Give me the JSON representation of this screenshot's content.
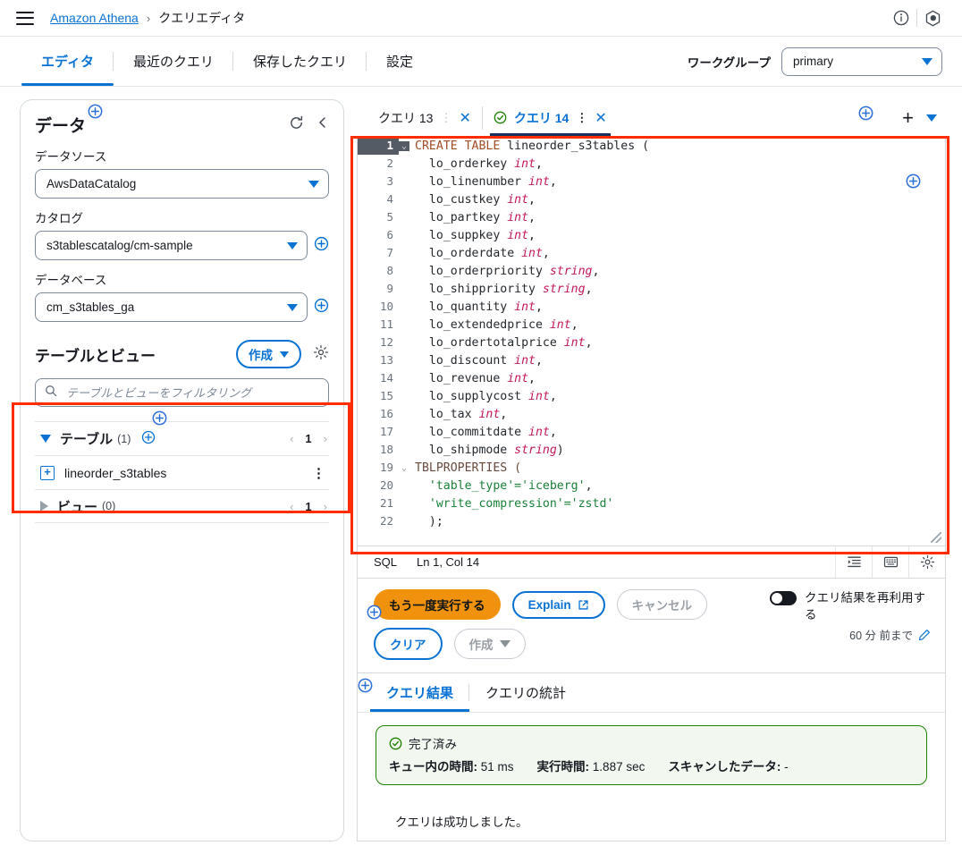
{
  "header": {
    "menu_icon": "hamburger-icon",
    "breadcrumb_root": "Amazon Athena",
    "breadcrumb_sep": "›",
    "breadcrumb_current": "クエリエディタ",
    "info_icon": "info-icon",
    "settings_icon": "app-settings-icon"
  },
  "main_tabs": [
    {
      "label": "エディタ",
      "active": true
    },
    {
      "label": "最近のクエリ",
      "active": false
    },
    {
      "label": "保存したクエリ",
      "active": false
    },
    {
      "label": "設定",
      "active": false
    }
  ],
  "workgroup": {
    "label": "ワークグループ",
    "value": "primary"
  },
  "sidebar": {
    "title": "データ",
    "refresh_icon": "refresh-icon",
    "collapse_icon": "chevron-left-icon",
    "fields": [
      {
        "label": "データソース",
        "value": "AwsDataCatalog",
        "has_add": false
      },
      {
        "label": "カタログ",
        "value": "s3tablescatalog/cm-sample",
        "has_add": true
      },
      {
        "label": "データベース",
        "value": "cm_s3tables_ga",
        "has_add": true
      }
    ],
    "tables_section": {
      "title": "テーブルとビュー",
      "create_button": "作成",
      "gear_icon": "gear-icon",
      "filter_placeholder": "テーブルとビューをフィルタリング",
      "filter_value": "",
      "search_icon": "search-icon",
      "tables_group": {
        "label": "テーブル",
        "count": "(1)",
        "page": "1"
      },
      "table_items": [
        {
          "name": "lineorder_s3tables"
        }
      ],
      "views_group": {
        "label": "ビュー",
        "count": "(0)",
        "page": "1"
      }
    }
  },
  "query_tabs": [
    {
      "label": "クエリ 13",
      "active": false,
      "status": ""
    },
    {
      "label": "クエリ 14",
      "active": true,
      "status": "success"
    }
  ],
  "editor": {
    "add_tab_icon": "plus-icon",
    "tab_menu_icon": "chevron-down-icon",
    "inline_add_icon": "circle-plus-icon",
    "lines": [
      {
        "n": "1",
        "fold": "⌄",
        "active": true,
        "tokens": [
          {
            "t": "CREATE TABLE ",
            "c": "kw"
          },
          {
            "t": "lineorder_s3tables (",
            "c": ""
          }
        ]
      },
      {
        "n": "2",
        "fold": "",
        "active": false,
        "tokens": [
          {
            "t": "  lo_orderkey ",
            "c": ""
          },
          {
            "t": "int",
            "c": "typ"
          },
          {
            "t": ",",
            "c": ""
          }
        ]
      },
      {
        "n": "3",
        "fold": "",
        "active": false,
        "tokens": [
          {
            "t": "  lo_linenumber ",
            "c": ""
          },
          {
            "t": "int",
            "c": "typ"
          },
          {
            "t": ",",
            "c": ""
          }
        ]
      },
      {
        "n": "4",
        "fold": "",
        "active": false,
        "tokens": [
          {
            "t": "  lo_custkey ",
            "c": ""
          },
          {
            "t": "int",
            "c": "typ"
          },
          {
            "t": ",",
            "c": ""
          }
        ]
      },
      {
        "n": "5",
        "fold": "",
        "active": false,
        "tokens": [
          {
            "t": "  lo_partkey ",
            "c": ""
          },
          {
            "t": "int",
            "c": "typ"
          },
          {
            "t": ",",
            "c": ""
          }
        ]
      },
      {
        "n": "6",
        "fold": "",
        "active": false,
        "tokens": [
          {
            "t": "  lo_suppkey ",
            "c": ""
          },
          {
            "t": "int",
            "c": "typ"
          },
          {
            "t": ",",
            "c": ""
          }
        ]
      },
      {
        "n": "7",
        "fold": "",
        "active": false,
        "tokens": [
          {
            "t": "  lo_orderdate ",
            "c": ""
          },
          {
            "t": "int",
            "c": "typ"
          },
          {
            "t": ",",
            "c": ""
          }
        ]
      },
      {
        "n": "8",
        "fold": "",
        "active": false,
        "tokens": [
          {
            "t": "  lo_orderpriority ",
            "c": ""
          },
          {
            "t": "string",
            "c": "typ"
          },
          {
            "t": ",",
            "c": ""
          }
        ]
      },
      {
        "n": "9",
        "fold": "",
        "active": false,
        "tokens": [
          {
            "t": "  lo_shippriority ",
            "c": ""
          },
          {
            "t": "string",
            "c": "typ"
          },
          {
            "t": ",",
            "c": ""
          }
        ]
      },
      {
        "n": "10",
        "fold": "",
        "active": false,
        "tokens": [
          {
            "t": "  lo_quantity ",
            "c": ""
          },
          {
            "t": "int",
            "c": "typ"
          },
          {
            "t": ",",
            "c": ""
          }
        ]
      },
      {
        "n": "11",
        "fold": "",
        "active": false,
        "tokens": [
          {
            "t": "  lo_extendedprice ",
            "c": ""
          },
          {
            "t": "int",
            "c": "typ"
          },
          {
            "t": ",",
            "c": ""
          }
        ]
      },
      {
        "n": "12",
        "fold": "",
        "active": false,
        "tokens": [
          {
            "t": "  lo_ordertotalprice ",
            "c": ""
          },
          {
            "t": "int",
            "c": "typ"
          },
          {
            "t": ",",
            "c": ""
          }
        ]
      },
      {
        "n": "13",
        "fold": "",
        "active": false,
        "tokens": [
          {
            "t": "  lo_discount ",
            "c": ""
          },
          {
            "t": "int",
            "c": "typ"
          },
          {
            "t": ",",
            "c": ""
          }
        ]
      },
      {
        "n": "14",
        "fold": "",
        "active": false,
        "tokens": [
          {
            "t": "  lo_revenue ",
            "c": ""
          },
          {
            "t": "int",
            "c": "typ"
          },
          {
            "t": ",",
            "c": ""
          }
        ]
      },
      {
        "n": "15",
        "fold": "",
        "active": false,
        "tokens": [
          {
            "t": "  lo_supplycost ",
            "c": ""
          },
          {
            "t": "int",
            "c": "typ"
          },
          {
            "t": ",",
            "c": ""
          }
        ]
      },
      {
        "n": "16",
        "fold": "",
        "active": false,
        "tokens": [
          {
            "t": "  lo_tax ",
            "c": ""
          },
          {
            "t": "int",
            "c": "typ"
          },
          {
            "t": ",",
            "c": ""
          }
        ]
      },
      {
        "n": "17",
        "fold": "",
        "active": false,
        "tokens": [
          {
            "t": "  lo_commitdate ",
            "c": ""
          },
          {
            "t": "int",
            "c": "typ"
          },
          {
            "t": ",",
            "c": ""
          }
        ]
      },
      {
        "n": "18",
        "fold": "",
        "active": false,
        "tokens": [
          {
            "t": "  lo_shipmode ",
            "c": ""
          },
          {
            "t": "string",
            "c": "typ"
          },
          {
            "t": ")",
            "c": ""
          }
        ]
      },
      {
        "n": "19",
        "fold": "⌄",
        "active": false,
        "tokens": [
          {
            "t": "TBLPROPERTIES (",
            "c": "tblprop"
          }
        ]
      },
      {
        "n": "20",
        "fold": "",
        "active": false,
        "tokens": [
          {
            "t": "  ",
            "c": ""
          },
          {
            "t": "'table_type'='iceberg'",
            "c": "str"
          },
          {
            "t": ",",
            "c": ""
          }
        ]
      },
      {
        "n": "21",
        "fold": "",
        "active": false,
        "tokens": [
          {
            "t": "  ",
            "c": ""
          },
          {
            "t": "'write_compression'='zstd'",
            "c": "str"
          }
        ]
      },
      {
        "n": "22",
        "fold": "",
        "active": false,
        "tokens": [
          {
            "t": "  );",
            "c": ""
          }
        ]
      }
    ]
  },
  "status_bar": {
    "language": "SQL",
    "cursor": "Ln 1, Col 14",
    "icons": [
      "indent-icon",
      "keyboard-icon",
      "gear-icon"
    ]
  },
  "actions": {
    "run_again": "もう一度実行する",
    "explain": "Explain",
    "explain_icon": "external-link-icon",
    "cancel": "キャンセル",
    "clear": "クリア",
    "create": "作成",
    "reuse_toggle_label": "クエリ結果を再利用する",
    "reuse_time": "60 分 前まで",
    "edit_icon": "pencil-icon"
  },
  "results": {
    "tabs": [
      {
        "label": "クエリ結果",
        "active": true
      },
      {
        "label": "クエリの統計",
        "active": false
      }
    ],
    "banner": {
      "status_icon": "check-circle-icon",
      "status": "完了済み",
      "stats": [
        {
          "label": "キュー内の時間:",
          "value": "51 ms"
        },
        {
          "label": "実行時間:",
          "value": "1.887 sec"
        },
        {
          "label": "スキャンしたデータ:",
          "value": "-"
        }
      ]
    },
    "message": "クエリは成功しました。"
  },
  "colors": {
    "accent_blue": "#0972d3",
    "annotation_red": "#ff2d00",
    "primary_orange": "#f0920d",
    "success_green": "#1d8102"
  }
}
